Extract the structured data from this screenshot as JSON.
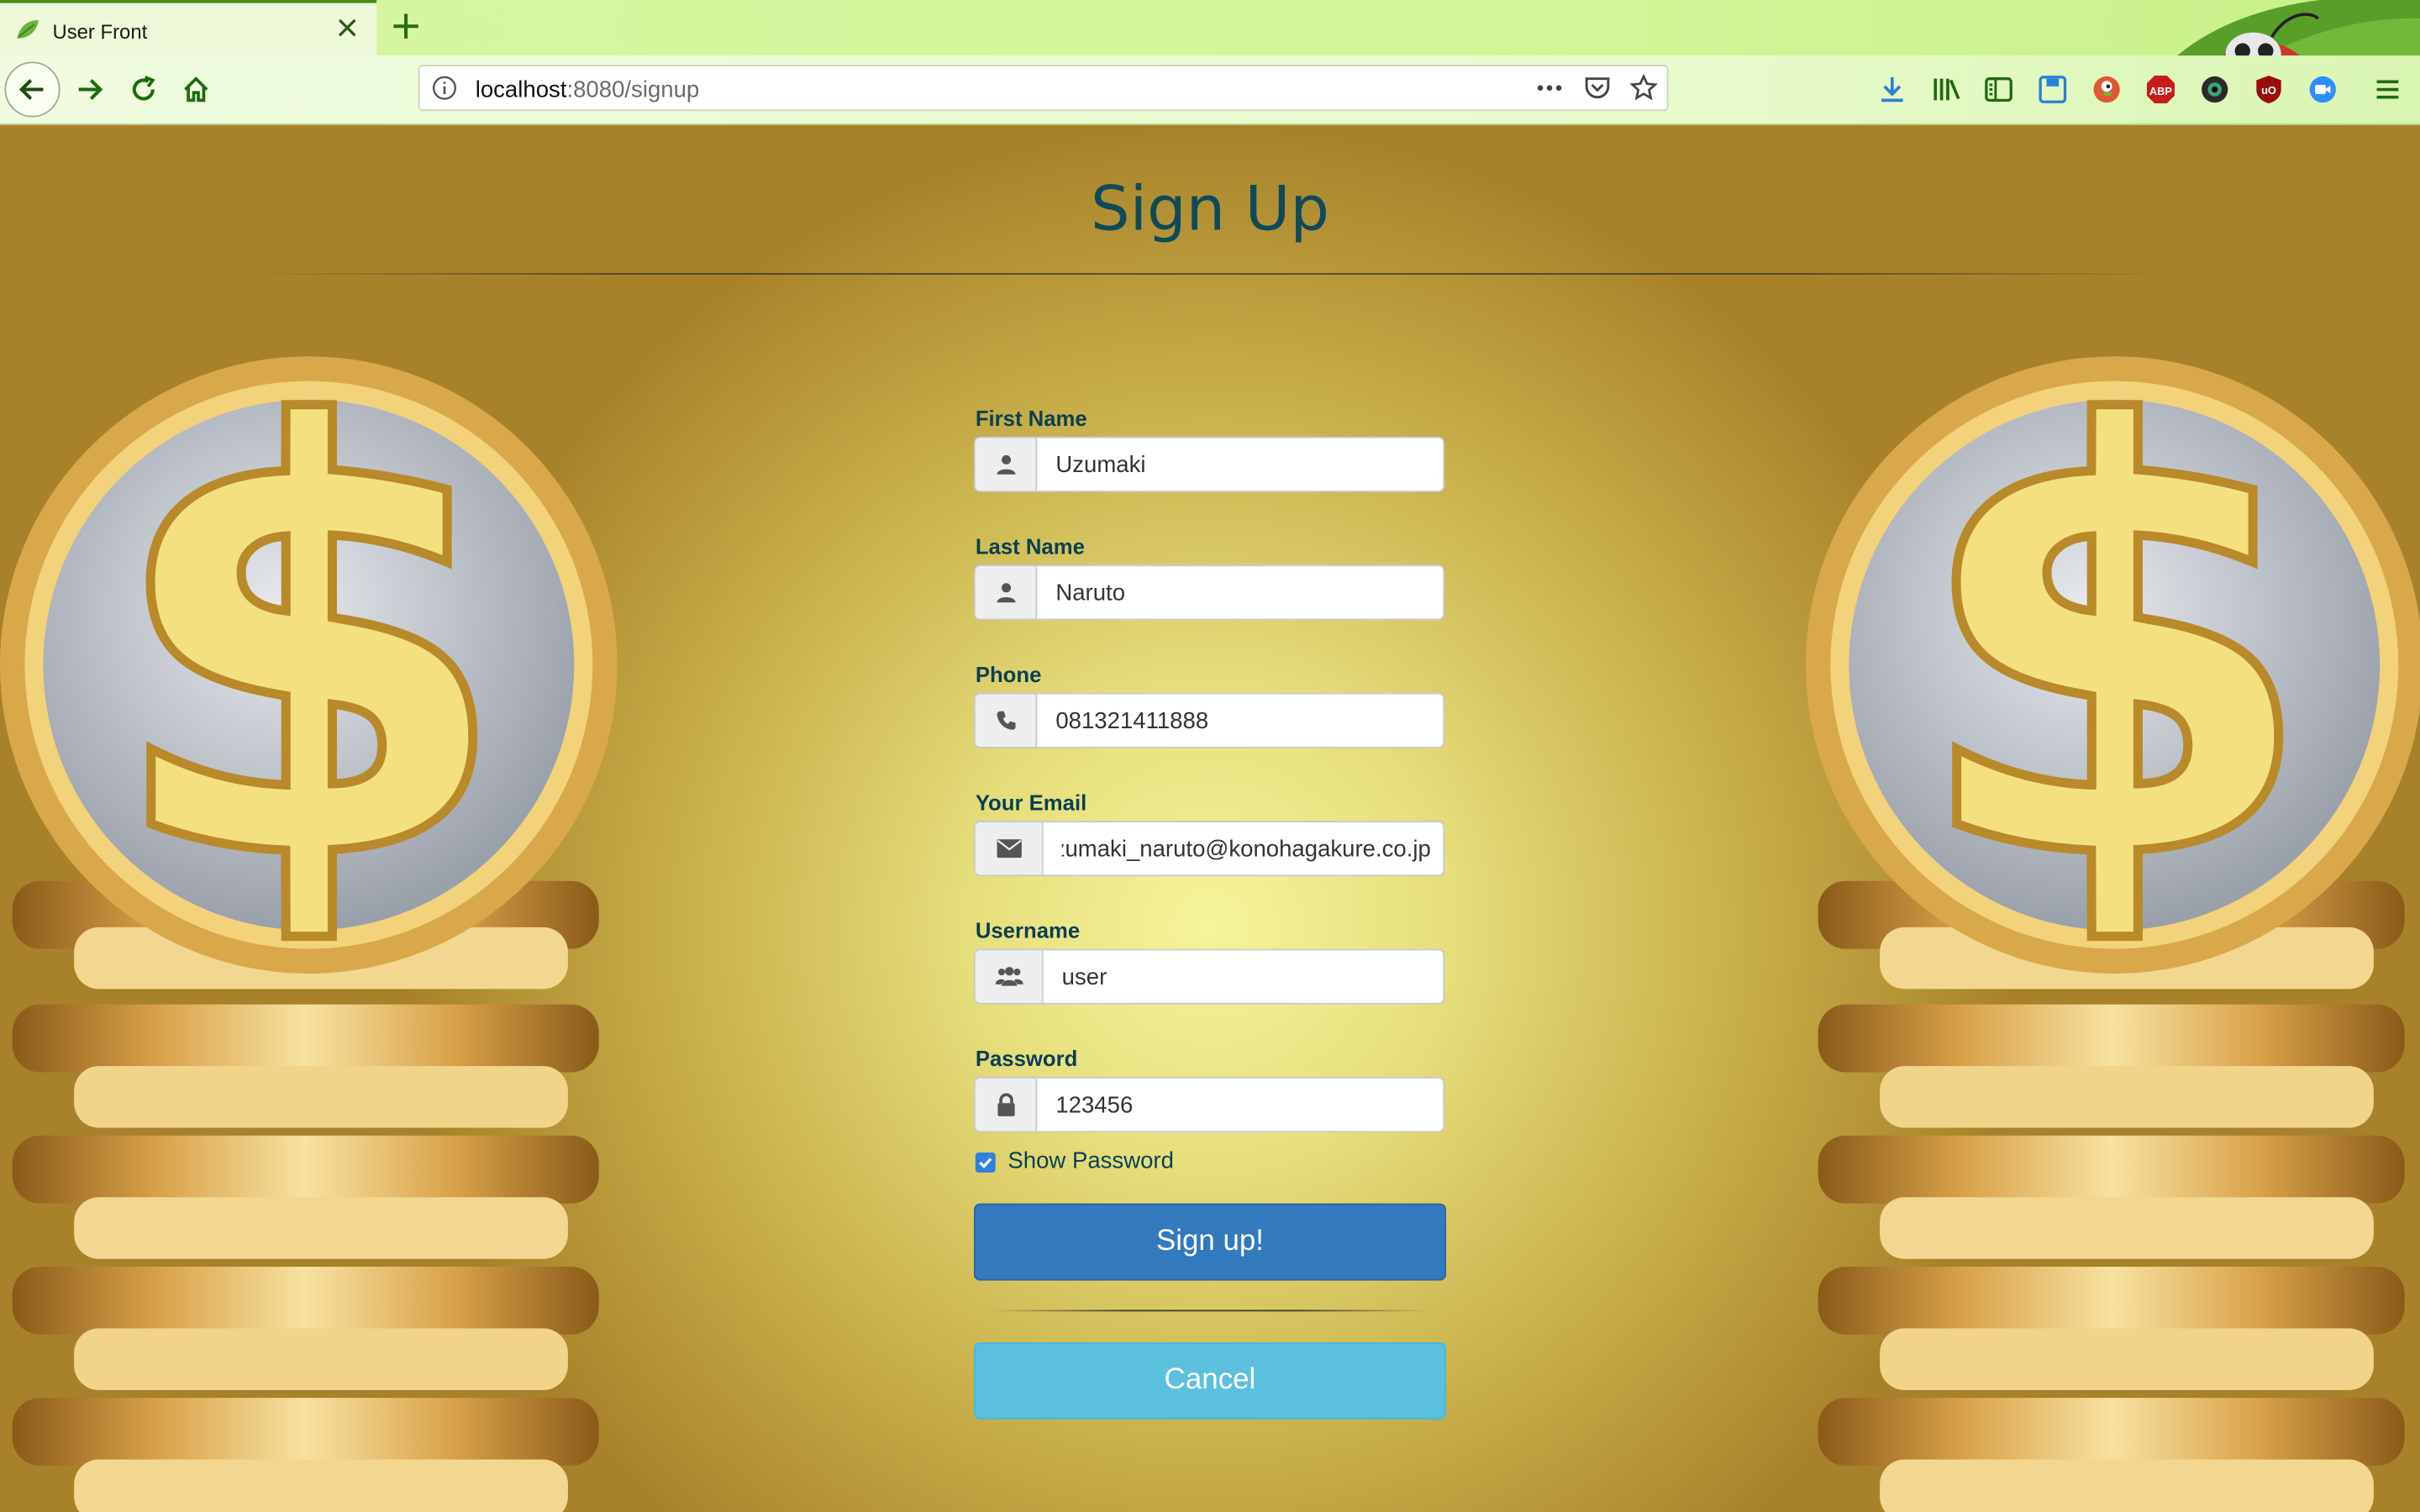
{
  "browser": {
    "tab_title": "User Front",
    "url_host": "localhost",
    "url_rest": ":8080/signup"
  },
  "page": {
    "title": "Sign Up",
    "fields": {
      "first_name": {
        "label": "First Name",
        "value": "Uzumaki",
        "icon": "user-icon"
      },
      "last_name": {
        "label": "Last Name",
        "value": "Naruto",
        "icon": "user-icon"
      },
      "phone": {
        "label": "Phone",
        "value": "081321411888",
        "icon": "phone-icon"
      },
      "email": {
        "label": "Your Email",
        "value": "uzumaki_naruto@konohagakure.co.jp",
        "icon": "envelope-icon"
      },
      "username": {
        "label": "Username",
        "value": "user",
        "icon": "users-icon"
      },
      "password": {
        "label": "Password",
        "value": "123456",
        "icon": "lock-icon"
      }
    },
    "show_password": {
      "label": "Show Password",
      "checked": true
    },
    "buttons": {
      "signup": "Sign up!",
      "cancel": "Cancel"
    }
  },
  "colors": {
    "title": "#0f4a5a",
    "label": "#0b3f52",
    "primary_button": "#3379bd",
    "info_button": "#5bc0de",
    "checkbox": "#2f7fe0"
  }
}
